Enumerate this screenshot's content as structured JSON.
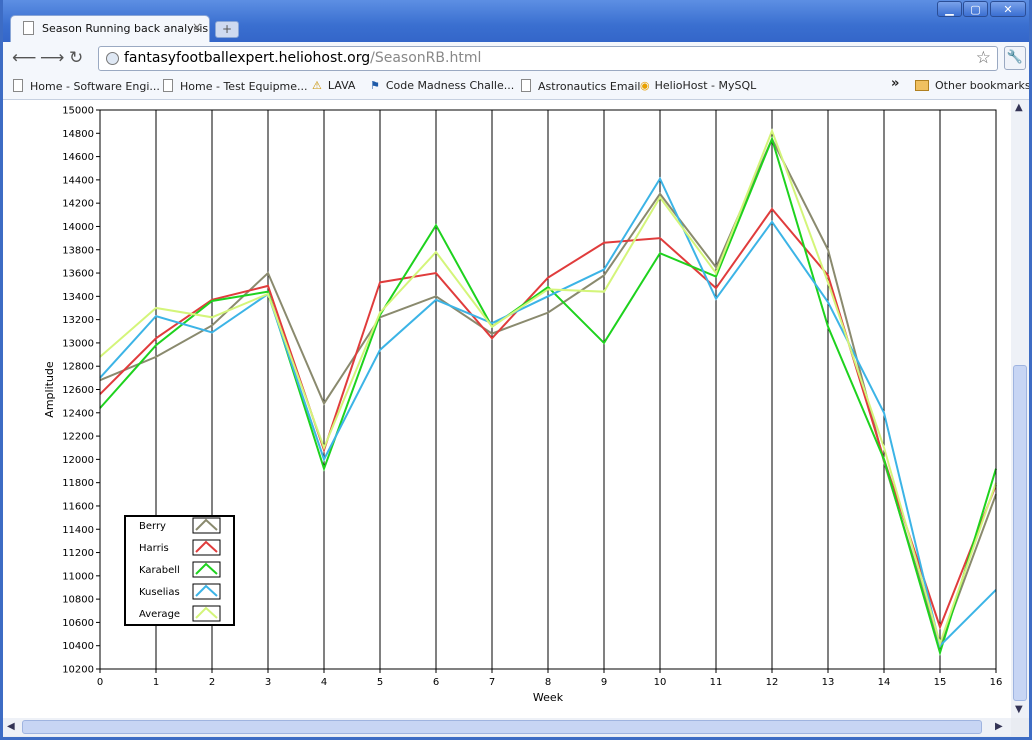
{
  "browser": {
    "tab_title": "Season Running back analysis",
    "url_host": "fantasyfootballexpert.heliohost.org",
    "url_path": "/SeasonRB.html",
    "bookmarks": [
      "Home - Software Engi...",
      "Home - Test Equipme...",
      "LAVA",
      "Code Madness Challe...",
      "Astronautics Email",
      "HelioHost - MySQL"
    ],
    "overflow_label": "»",
    "other_bookmarks": "Other bookmarks"
  },
  "chart_data": {
    "type": "line",
    "xlabel": "Week",
    "ylabel": "Amplitude",
    "x": [
      0,
      1,
      2,
      3,
      4,
      5,
      6,
      7,
      8,
      9,
      10,
      11,
      12,
      13,
      14,
      15,
      16
    ],
    "ylim": [
      10200,
      15000
    ],
    "xlim": [
      0,
      16
    ],
    "grid": "vertical",
    "legend": "bottom-left",
    "series": [
      {
        "name": "Berry",
        "color": "#8a8a6e",
        "values": [
          12680,
          12880,
          13150,
          13600,
          12480,
          13220,
          13400,
          13080,
          13260,
          13580,
          14280,
          13650,
          14750,
          13800,
          11980,
          10400,
          11700
        ]
      },
      {
        "name": "Harris",
        "color": "#e03c3c",
        "values": [
          12560,
          13040,
          13370,
          13490,
          12080,
          13520,
          13600,
          13040,
          13560,
          13860,
          13900,
          13470,
          14150,
          13580,
          12000,
          10560,
          11780
        ]
      },
      {
        "name": "Karabell",
        "color": "#1ed21e",
        "values": [
          12440,
          12980,
          13360,
          13440,
          11920,
          13240,
          14010,
          13140,
          13480,
          13000,
          13770,
          13570,
          14750,
          13140,
          12000,
          10340,
          11920
        ]
      },
      {
        "name": "Kuselias",
        "color": "#3cb4e6",
        "values": [
          12700,
          13230,
          13090,
          13420,
          12000,
          12940,
          13370,
          13170,
          13400,
          13630,
          14410,
          13380,
          14040,
          13350,
          12400,
          10400,
          10880
        ]
      },
      {
        "name": "Average",
        "color": "#d4f57a",
        "values": [
          12880,
          13300,
          13220,
          13420,
          12100,
          13260,
          13780,
          13140,
          13460,
          13440,
          14250,
          13600,
          14820,
          13520,
          12100,
          10420,
          11800
        ]
      }
    ]
  }
}
